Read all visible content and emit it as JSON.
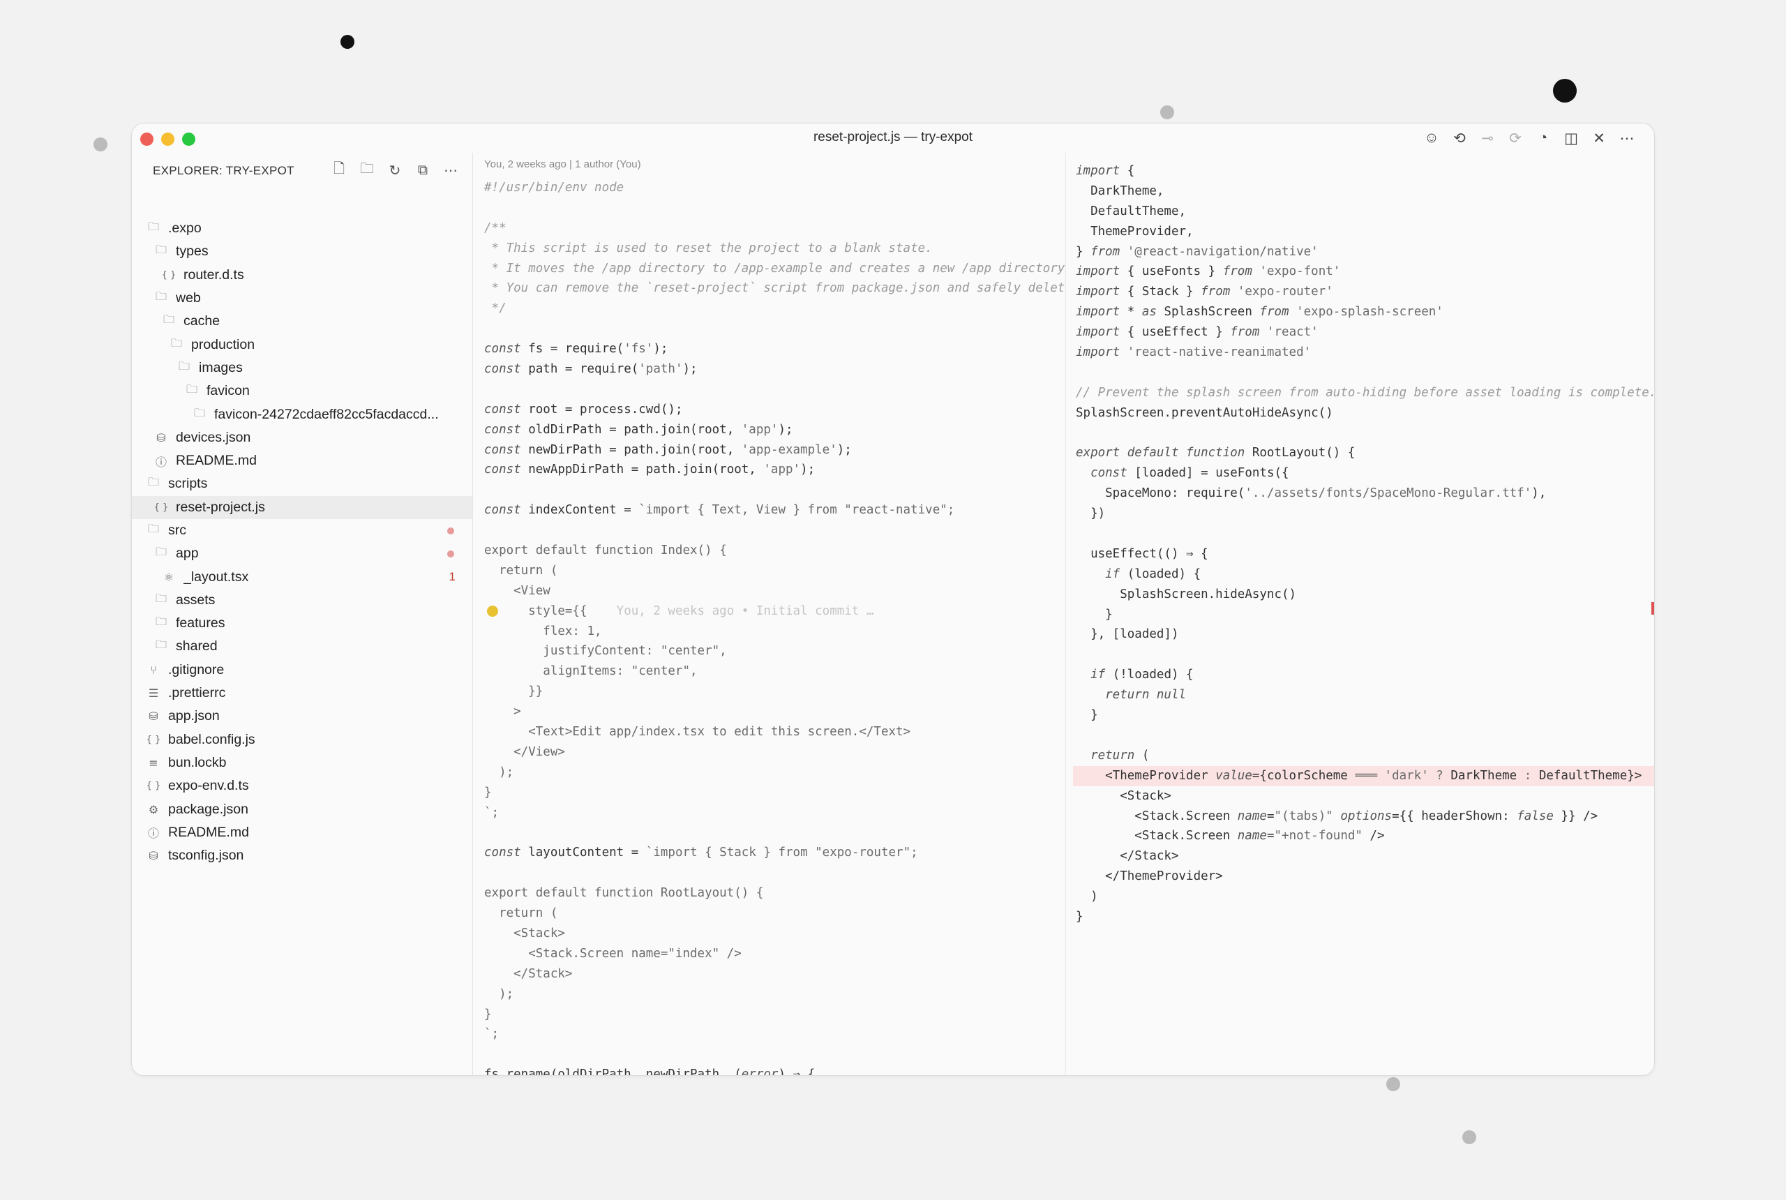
{
  "window": {
    "title": "reset-project.js — try-expot",
    "traffic_lights": {
      "close": "#ee5f57",
      "minimize": "#f5bd2f",
      "zoom": "#28c840"
    },
    "toolbar_icons": [
      "copilot-icon",
      "go-back-icon",
      "git-commit-icon",
      "go-forward-icon",
      "open-changes-icon",
      "split-editor-icon",
      "close-icon",
      "more-icon"
    ]
  },
  "explorer": {
    "header": "EXPLORER: TRY-EXPOT",
    "actions": [
      "new-file-icon",
      "new-folder-icon",
      "refresh-icon",
      "collapse-icon",
      "more-icon"
    ],
    "items": [
      {
        "label": ".expo",
        "icon": "folder",
        "level": 0
      },
      {
        "label": "types",
        "icon": "folder",
        "level": 1
      },
      {
        "label": "router.d.ts",
        "icon": "braces",
        "level": 2
      },
      {
        "label": "web",
        "icon": "folder",
        "level": 1
      },
      {
        "label": "cache",
        "icon": "folder",
        "level": 2
      },
      {
        "label": "production",
        "icon": "folder",
        "level": 3
      },
      {
        "label": "images",
        "icon": "folder",
        "level": 4
      },
      {
        "label": "favicon",
        "icon": "folder",
        "level": 5
      },
      {
        "label": "favicon-24272cdaeff82cc5facdaccd...",
        "icon": "folder",
        "level": 6
      },
      {
        "label": "devices.json",
        "icon": "database",
        "level": 1
      },
      {
        "label": "README.md",
        "icon": "info",
        "level": 1
      },
      {
        "label": "scripts",
        "icon": "folder",
        "level": 0
      },
      {
        "label": "reset-project.js",
        "icon": "braces",
        "level": 1,
        "selected": true
      },
      {
        "label": "src",
        "icon": "folder",
        "level": 0,
        "modified": true
      },
      {
        "label": "app",
        "icon": "folder",
        "level": 1,
        "modified": true
      },
      {
        "label": "_layout.tsx",
        "icon": "react",
        "level": 2,
        "problems": "1"
      },
      {
        "label": "assets",
        "icon": "folder",
        "level": 1
      },
      {
        "label": "features",
        "icon": "folder",
        "level": 1
      },
      {
        "label": "shared",
        "icon": "folder",
        "level": 1
      },
      {
        "label": ".gitignore",
        "icon": "git",
        "level": 0
      },
      {
        "label": ".prettierrc",
        "icon": "list",
        "level": 0
      },
      {
        "label": "app.json",
        "icon": "database",
        "level": 0
      },
      {
        "label": "babel.config.js",
        "icon": "braces",
        "level": 0
      },
      {
        "label": "bun.lockb",
        "icon": "lines",
        "level": 0
      },
      {
        "label": "expo-env.d.ts",
        "icon": "braces",
        "level": 0
      },
      {
        "label": "package.json",
        "icon": "gear",
        "level": 0
      },
      {
        "label": "README.md",
        "icon": "info",
        "level": 0
      },
      {
        "label": "tsconfig.json",
        "icon": "database",
        "level": 0
      }
    ]
  },
  "editor_left": {
    "blame_header": "You, 2 weeks ago | 1 author (You)",
    "inline_blame": "You, 2 weeks ago • Initial commit …",
    "lines": [
      [
        [
          "c",
          "#!/usr/bin/env node"
        ]
      ],
      [],
      [
        [
          "c",
          "/**"
        ]
      ],
      [
        [
          "c",
          " * This script is used to reset the project to a blank state."
        ]
      ],
      [
        [
          "c",
          " * It moves the /app directory to /app-example and creates a new /app directory with an index.tsx and _layout.tsx file."
        ]
      ],
      [
        [
          "c",
          " * You can remove the `reset-project` script from package.json and safely delete this file after running it."
        ]
      ],
      [
        [
          "c",
          " */"
        ]
      ],
      [],
      [
        [
          "k",
          "const"
        ],
        [
          "t",
          " fs = require("
        ],
        [
          "s",
          "'fs'"
        ],
        [
          "t",
          ");"
        ]
      ],
      [
        [
          "k",
          "const"
        ],
        [
          "t",
          " path = require("
        ],
        [
          "s",
          "'path'"
        ],
        [
          "t",
          ");"
        ]
      ],
      [],
      [
        [
          "k",
          "const"
        ],
        [
          "t",
          " root = process.cwd();"
        ]
      ],
      [
        [
          "k",
          "const"
        ],
        [
          "t",
          " oldDirPath = path.join(root, "
        ],
        [
          "s",
          "'app'"
        ],
        [
          "t",
          ");"
        ]
      ],
      [
        [
          "k",
          "const"
        ],
        [
          "t",
          " newDirPath = path.join(root, "
        ],
        [
          "s",
          "'app-example'"
        ],
        [
          "t",
          ");"
        ]
      ],
      [
        [
          "k",
          "const"
        ],
        [
          "t",
          " newAppDirPath = path.join(root, "
        ],
        [
          "s",
          "'app'"
        ],
        [
          "t",
          ");"
        ]
      ],
      [],
      [
        [
          "k",
          "const"
        ],
        [
          "t",
          " indexContent = "
        ],
        [
          "s",
          "`import { Text, View } from \"react-native\";"
        ]
      ],
      [],
      [
        [
          "s",
          "export default function Index() {"
        ]
      ],
      [
        [
          "s",
          "  return ("
        ]
      ],
      [
        [
          "s",
          "    <View"
        ]
      ],
      [
        [
          "s",
          "      style={{"
        ]
      ],
      [
        [
          "s",
          "        flex: 1,"
        ]
      ],
      [
        [
          "s",
          "        justifyContent: \"center\","
        ]
      ],
      [
        [
          "s",
          "        alignItems: \"center\","
        ]
      ],
      [
        [
          "s",
          "      }}"
        ]
      ],
      [
        [
          "s",
          "    >"
        ]
      ],
      [
        [
          "s",
          "      <Text>Edit app/index.tsx to edit this screen.</Text>"
        ]
      ],
      [
        [
          "s",
          "    </View>"
        ]
      ],
      [
        [
          "s",
          "  );"
        ]
      ],
      [
        [
          "s",
          "}"
        ]
      ],
      [
        [
          "s",
          "`;"
        ]
      ],
      [],
      [
        [
          "k",
          "const"
        ],
        [
          "t",
          " layoutContent = "
        ],
        [
          "s",
          "`import { Stack } from \"expo-router\";"
        ]
      ],
      [],
      [
        [
          "s",
          "export default function RootLayout() {"
        ]
      ],
      [
        [
          "s",
          "  return ("
        ]
      ],
      [
        [
          "s",
          "    <Stack>"
        ]
      ],
      [
        [
          "s",
          "      <Stack.Screen name=\"index\" />"
        ]
      ],
      [
        [
          "s",
          "    </Stack>"
        ]
      ],
      [
        [
          "s",
          "  );"
        ]
      ],
      [
        [
          "s",
          "}"
        ]
      ],
      [
        [
          "s",
          "`;"
        ]
      ],
      [],
      [
        [
          "t",
          "fs.rename(oldDirPath, newDirPath, ("
        ],
        [
          "k",
          "error"
        ],
        [
          "t",
          ") ⇒ {"
        ]
      ]
    ]
  },
  "editor_right": {
    "lines": [
      [
        [
          "k",
          "import"
        ],
        [
          "t",
          " {"
        ]
      ],
      [
        [
          "t",
          "  DarkTheme,"
        ]
      ],
      [
        [
          "t",
          "  DefaultTheme,"
        ]
      ],
      [
        [
          "t",
          "  ThemeProvider,"
        ]
      ],
      [
        [
          "t",
          "} "
        ],
        [
          "k",
          "from"
        ],
        [
          "s",
          " '@react-navigation/native'"
        ]
      ],
      [
        [
          "k",
          "import"
        ],
        [
          "t",
          " { useFonts } "
        ],
        [
          "k",
          "from"
        ],
        [
          "s",
          " 'expo-font'"
        ]
      ],
      [
        [
          "k",
          "import"
        ],
        [
          "t",
          " { Stack } "
        ],
        [
          "k",
          "from"
        ],
        [
          "s",
          " 'expo-router'"
        ]
      ],
      [
        [
          "k",
          "import"
        ],
        [
          "t",
          " * "
        ],
        [
          "k",
          "as"
        ],
        [
          "t",
          " SplashScreen "
        ],
        [
          "k",
          "from"
        ],
        [
          "s",
          " 'expo-splash-screen'"
        ]
      ],
      [
        [
          "k",
          "import"
        ],
        [
          "t",
          " { useEffect } "
        ],
        [
          "k",
          "from"
        ],
        [
          "s",
          " 'react'"
        ]
      ],
      [
        [
          "k",
          "import"
        ],
        [
          "s",
          " 'react-native-reanimated'"
        ]
      ],
      [],
      [
        [
          "c",
          "// Prevent the splash screen from auto-hiding before asset loading is complete."
        ]
      ],
      [
        [
          "t",
          "SplashScreen.preventAutoHideAsync()"
        ]
      ],
      [],
      [
        [
          "k",
          "export default function"
        ],
        [
          "t",
          " RootLayout() {"
        ]
      ],
      [
        [
          "k",
          "  const"
        ],
        [
          "t",
          " [loaded] = useFonts({"
        ]
      ],
      [
        [
          "t",
          "    SpaceMono: require("
        ],
        [
          "s",
          "'../assets/fonts/SpaceMono-Regular.ttf'"
        ],
        [
          "t",
          "),"
        ]
      ],
      [
        [
          "t",
          "  })"
        ]
      ],
      [],
      [
        [
          "t",
          "  useEffect(() ⇒ {"
        ]
      ],
      [
        [
          "k",
          "    if"
        ],
        [
          "t",
          " (loaded) {"
        ]
      ],
      [
        [
          "t",
          "      SplashScreen.hideAsync()"
        ]
      ],
      [
        [
          "t",
          "    }"
        ]
      ],
      [
        [
          "t",
          "  }, [loaded])"
        ]
      ],
      [],
      [
        [
          "k",
          "  if"
        ],
        [
          "t",
          " (!loaded) {"
        ]
      ],
      [
        [
          "k",
          "    return null"
        ]
      ],
      [
        [
          "t",
          "  }"
        ]
      ],
      [],
      [
        [
          "k",
          "  return"
        ],
        [
          "t",
          " ("
        ]
      ],
      [
        [
          "t",
          "    <ThemeProvider "
        ],
        [
          "k",
          "value"
        ],
        [
          "t",
          "={colorScheme "
        ],
        [
          "s",
          "═══ 'dark' ?"
        ],
        [
          "t",
          " DarkTheme "
        ],
        [
          "s",
          ":"
        ],
        [
          "t",
          " DefaultTheme}>"
        ]
      ],
      [
        [
          "t",
          "      <Stack>"
        ]
      ],
      [
        [
          "t",
          "        <Stack.Screen "
        ],
        [
          "k",
          "name"
        ],
        [
          "t",
          "="
        ],
        [
          "s",
          "\"(tabs)\""
        ],
        [
          "t",
          " "
        ],
        [
          "k",
          "options"
        ],
        [
          "t",
          "={{ headerShown: "
        ],
        [
          "k",
          "false"
        ],
        [
          "t",
          " }} />"
        ]
      ],
      [
        [
          "t",
          "        <Stack.Screen "
        ],
        [
          "k",
          "name"
        ],
        [
          "t",
          "="
        ],
        [
          "s",
          "\"+not-found\""
        ],
        [
          "t",
          " />"
        ]
      ],
      [
        [
          "t",
          "      </Stack>"
        ]
      ],
      [
        [
          "t",
          "    </ThemeProvider>"
        ]
      ],
      [
        [
          "t",
          "  )"
        ]
      ],
      [
        [
          "t",
          "}"
        ]
      ]
    ]
  }
}
